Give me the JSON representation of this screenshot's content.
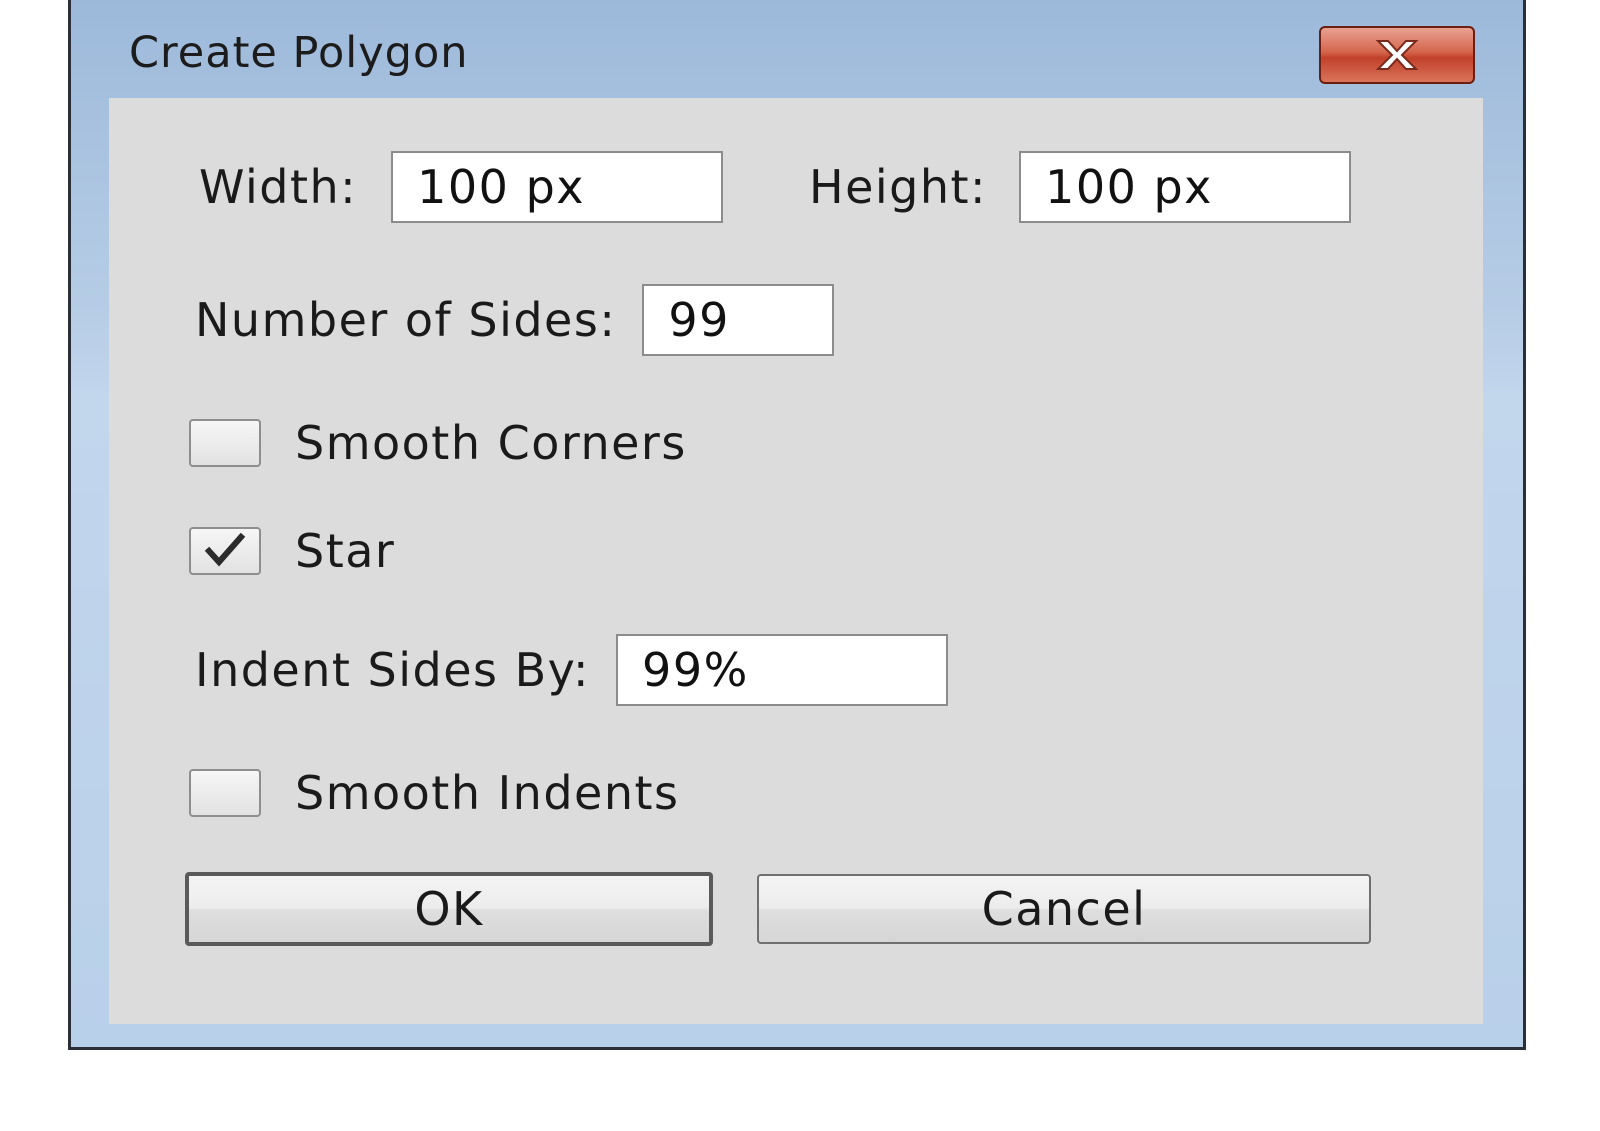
{
  "dialog": {
    "title": "Create Polygon",
    "close_icon": "close-icon",
    "width": {
      "label": "Width:",
      "value": "100 px"
    },
    "height": {
      "label": "Height:",
      "value": "100 px"
    },
    "sides": {
      "label": "Number of Sides:",
      "value": "99"
    },
    "smooth_corners": {
      "label": "Smooth Corners",
      "checked": false
    },
    "star": {
      "label": "Star",
      "checked": true
    },
    "indent": {
      "label": "Indent Sides By:",
      "value": "99%"
    },
    "smooth_indents": {
      "label": "Smooth Indents",
      "checked": false
    },
    "ok_label": "OK",
    "cancel_label": "Cancel"
  }
}
